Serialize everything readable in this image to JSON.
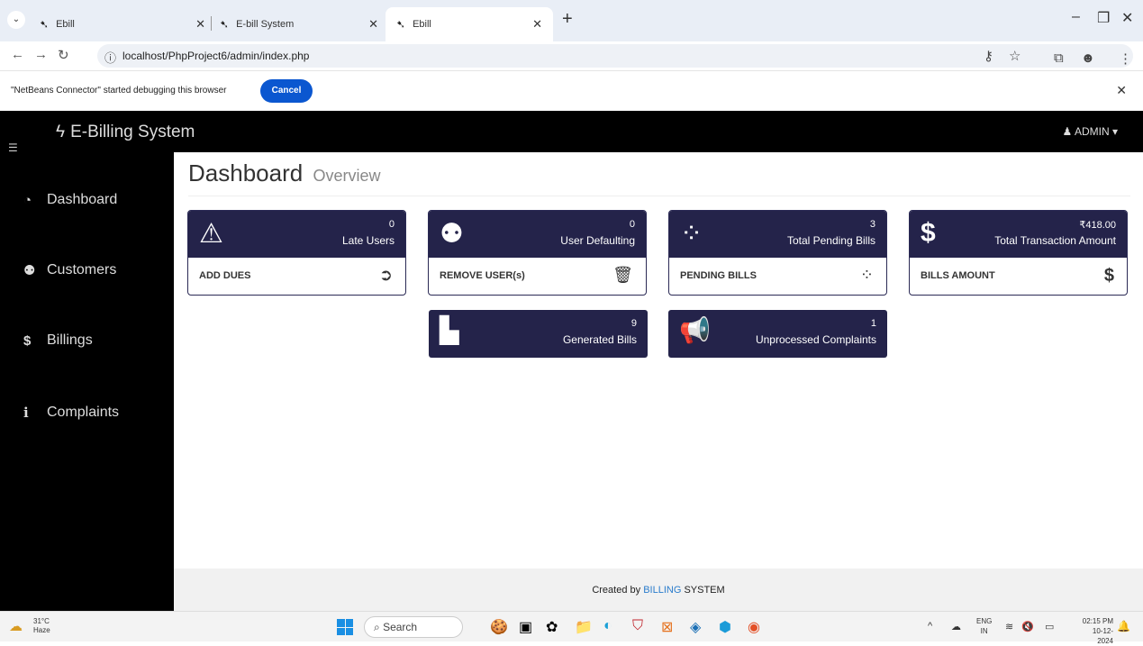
{
  "browser": {
    "tabs": [
      {
        "title": "Ebill",
        "active": false
      },
      {
        "title": "E-bill System",
        "active": false
      },
      {
        "title": "Ebill",
        "active": true
      }
    ],
    "new_tab": "+",
    "url": "localhost/PhpProject6/admin/index.php",
    "infobar": {
      "message": "\"NetBeans Connector\" started debugging this browser",
      "cancel_label": "Cancel"
    }
  },
  "app": {
    "brand": "E-Billing System",
    "user_menu": "ADMIN"
  },
  "sidebar": {
    "items": [
      {
        "label": "Dashboard",
        "icon": "dashboard-icon"
      },
      {
        "label": "Customers",
        "icon": "users-icon"
      },
      {
        "label": "Billings",
        "icon": "dollar-icon"
      },
      {
        "label": "Complaints",
        "icon": "info-icon"
      }
    ]
  },
  "main": {
    "title": "Dashboard",
    "subtitle": "Overview",
    "cards": [
      {
        "count": "0",
        "label": "Late Users",
        "footer": "ADD DUES",
        "icon": "warning-icon",
        "footer_icon": "arrow-circle-right-icon"
      },
      {
        "count": "0",
        "label": "User Defaulting",
        "footer": "REMOVE USER(s)",
        "icon": "users-icon",
        "footer_icon": "trash-icon"
      },
      {
        "count": "3",
        "label": "Total Pending Bills",
        "footer": "PENDING BILLS",
        "icon": "spinner-icon",
        "footer_icon": "spinner-icon"
      },
      {
        "count": "₹418.00",
        "label": "Total Transaction Amount",
        "footer": "BILLS AMOUNT",
        "icon": "dollar-icon",
        "footer_icon": "dollar-icon"
      }
    ],
    "small_cards": [
      {
        "count": "9",
        "label": "Generated Bills",
        "icon": "file-icon"
      },
      {
        "count": "1",
        "label": "Unprocessed Complaints",
        "icon": "megaphone-icon"
      }
    ]
  },
  "footer": {
    "prefix": "Created by",
    "brand": "BILLING",
    "suffix": "SYSTEM"
  },
  "taskbar": {
    "temperature": "31°C",
    "condition": "Haze",
    "search_placeholder": "Search",
    "lang": "ENG",
    "region": "IN",
    "time": "02:15 PM",
    "date": "10-12-2024"
  }
}
